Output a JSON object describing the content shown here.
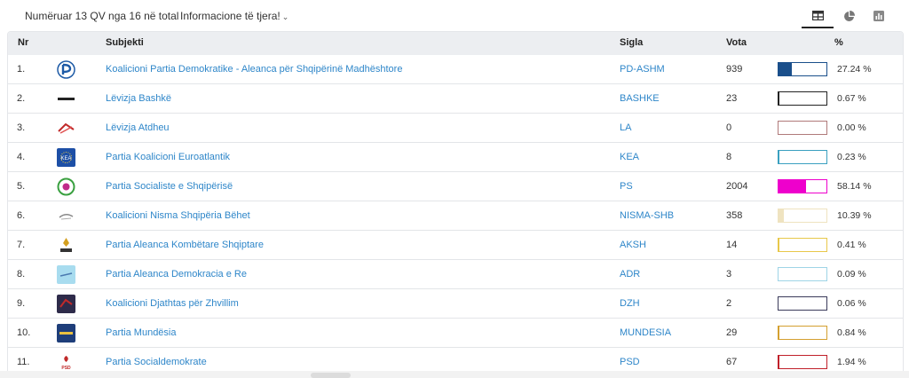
{
  "toolbar": {
    "counted": "Numëruar 13 QV nga 16 në total",
    "more_info": "Informacione të tjera!"
  },
  "view_tabs": [
    {
      "icon": "table-icon",
      "active": true
    },
    {
      "icon": "pie-chart-icon",
      "active": false
    },
    {
      "icon": "bar-chart-icon",
      "active": false
    }
  ],
  "table": {
    "headers": {
      "nr": "Nr",
      "subject": "Subjekti",
      "abbr": "Sigla",
      "votes": "Vota",
      "pct": "%"
    },
    "rows": [
      {
        "nr": "1.",
        "name": "Koalicioni Partia Demokratike - Aleanca për Shqipërinë Madhështore",
        "abbr": "PD-ASHM",
        "votes": "939",
        "pct": "27.24 %",
        "share": 0.2724,
        "color": "#1a4f8b",
        "logo": "pd-logo"
      },
      {
        "nr": "2.",
        "name": "Lëvizja Bashkë",
        "abbr": "BASHKE",
        "votes": "23",
        "pct": "0.67 %",
        "share": 0.0067,
        "color": "#222222",
        "logo": "bashke-logo"
      },
      {
        "nr": "3.",
        "name": "Lëvizja Atdheu",
        "abbr": "LA",
        "votes": "0",
        "pct": "0.00 %",
        "share": 0.0,
        "color": "#b07a7a",
        "logo": "la-logo"
      },
      {
        "nr": "4.",
        "name": "Partia Koalicioni Euroatlantik",
        "abbr": "KEA",
        "votes": "8",
        "pct": "0.23 %",
        "share": 0.0023,
        "color": "#3aa0c0",
        "logo": "kea-logo"
      },
      {
        "nr": "5.",
        "name": "Partia Socialiste e Shqipërisë",
        "abbr": "PS",
        "votes": "2004",
        "pct": "58.14 %",
        "share": 0.5814,
        "color": "#ee00cc",
        "logo": "ps-logo"
      },
      {
        "nr": "6.",
        "name": "Koalicioni Nisma Shqipëria Bëhet",
        "abbr": "NISMA-SHB",
        "votes": "358",
        "pct": "10.39 %",
        "share": 0.1039,
        "color": "#efe3c0",
        "logo": "nisma-logo"
      },
      {
        "nr": "7.",
        "name": "Partia Aleanca Kombëtare Shqiptare",
        "abbr": "AKSH",
        "votes": "14",
        "pct": "0.41 %",
        "share": 0.0041,
        "color": "#e8c84a",
        "logo": "aksh-logo"
      },
      {
        "nr": "8.",
        "name": "Partia Aleanca Demokracia e Re",
        "abbr": "ADR",
        "votes": "3",
        "pct": "0.09 %",
        "share": 0.0009,
        "color": "#9ed4e6",
        "logo": "adr-logo"
      },
      {
        "nr": "9.",
        "name": "Koalicioni Djathtas për Zhvillim",
        "abbr": "DZH",
        "votes": "2",
        "pct": "0.06 %",
        "share": 0.0006,
        "color": "#3a3a5a",
        "logo": "dzh-logo"
      },
      {
        "nr": "10.",
        "name": "Partia Mundësia",
        "abbr": "MUNDESIA",
        "votes": "29",
        "pct": "0.84 %",
        "share": 0.0084,
        "color": "#d4a030",
        "logo": "mundesia-logo"
      },
      {
        "nr": "11.",
        "name": "Partia Socialdemokrate",
        "abbr": "PSD",
        "votes": "67",
        "pct": "1.94 %",
        "share": 0.0194,
        "color": "#c0202a",
        "logo": "psd-logo"
      }
    ]
  }
}
